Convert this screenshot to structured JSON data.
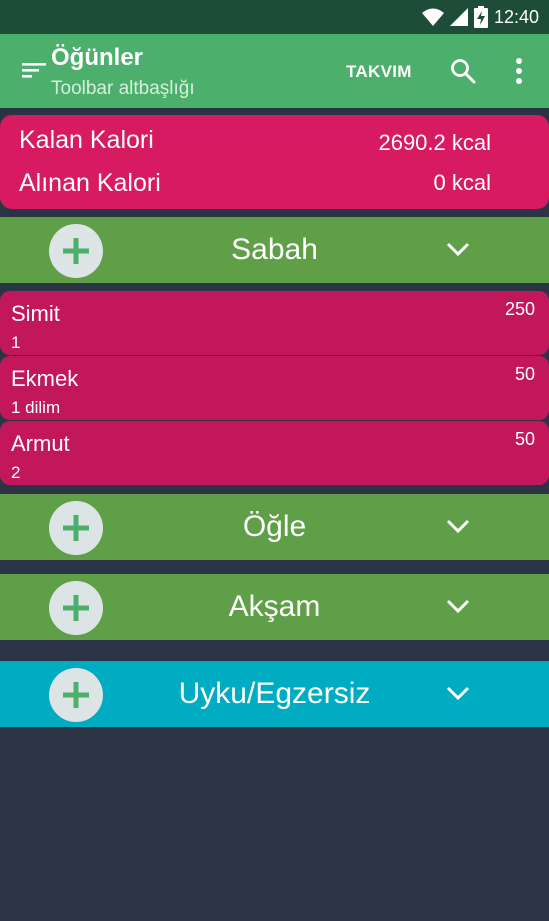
{
  "status_bar": {
    "time": "12:40",
    "icons": [
      "wifi-icon",
      "signal-icon",
      "battery-charging-icon"
    ]
  },
  "toolbar": {
    "title": "Öğünler",
    "subtitle": "Toolbar altbaşlığı",
    "action_calendar": "TAKVIM",
    "icons": [
      "menu-icon",
      "search-icon",
      "more-vert-icon"
    ]
  },
  "summary": {
    "remaining_label": "Kalan Kalori",
    "remaining_value": "2690.2 kcal",
    "taken_label": "Alınan Kalori",
    "taken_value": "0 kcal"
  },
  "meals": [
    {
      "title": "Sabah",
      "items": [
        {
          "name": "Simit",
          "qty": "1",
          "cal": "250"
        },
        {
          "name": "Ekmek",
          "qty": "1 dilim",
          "cal": "50"
        },
        {
          "name": "Armut",
          "qty": "2",
          "cal": "50"
        }
      ]
    },
    {
      "title": "Öğle",
      "items": []
    },
    {
      "title": "Akşam",
      "items": []
    },
    {
      "title": "Uyku/Egzersiz",
      "items": []
    }
  ],
  "colors": {
    "toolbar": "#4caf6b",
    "status_bar": "#1d4d36",
    "summary_card": "#d81b60",
    "item_card": "#c2185b",
    "meal_header": "#5e9f47",
    "sleep_header": "#00acc1",
    "background": "#2a3445",
    "add_button": "#dde4e6",
    "add_icon": "#4caf6b"
  }
}
